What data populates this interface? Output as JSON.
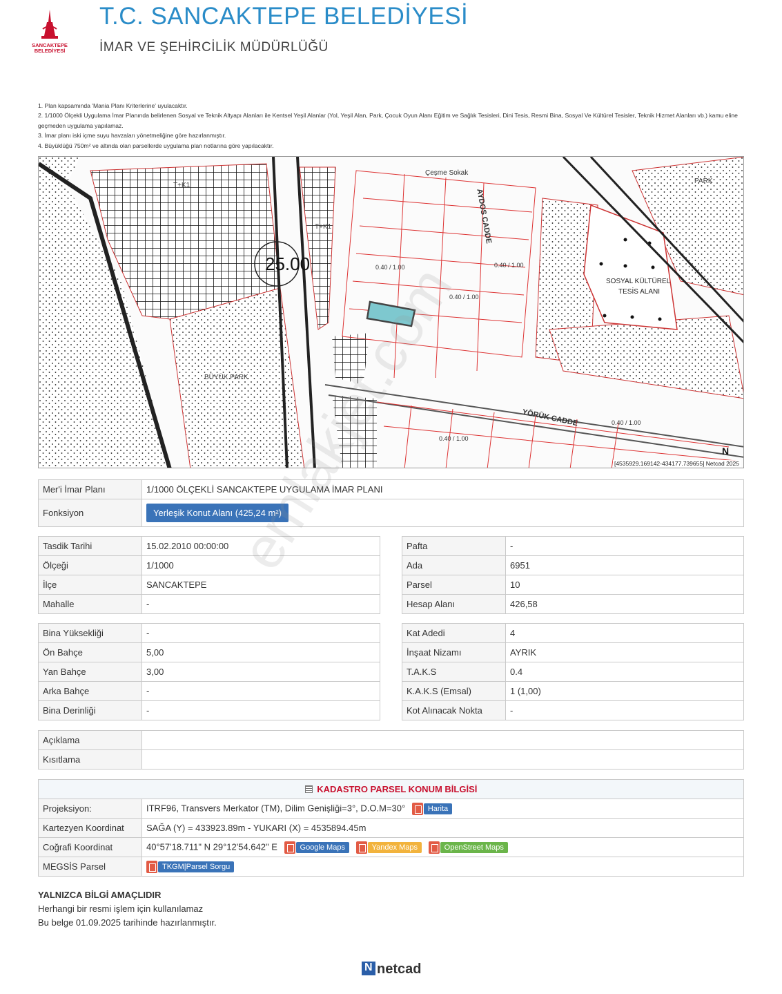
{
  "header": {
    "logo_text": "SANCAKTEPE BELEDİYESİ",
    "title": "T.C. SANCAKTEPE BELEDİYESİ",
    "subtitle": "İMAR VE ŞEHİRCİLİK MÜDÜRLÜĞÜ"
  },
  "notes": [
    "1. Plan kapsamında 'Mania Planı Kriterlerine' uyulacaktır.",
    "2. 1/1000 Ölçekli Uygulama İmar Planında belirlenen Sosyal ve Teknik Altyapı Alanları ile Kentsel Yeşil Alanlar (Yol, Yeşil Alan, Park, Çocuk Oyun Alanı Eğitim ve Sağlık Tesisleri, Dini Tesis, Resmi Bina, Sosyal Ve Kültürel Tesisler, Teknik Hizmet Alanları vb.) kamu eline geçmeden uygulama yapılamaz.",
    "3. İmar planı iski içme suyu havzaları yönetmeliğine göre hazırlanmıştır.",
    "4. Büyüklüğü 750m² ve altında olan parsellerde uygulama plan notlarına göre yapılacaktır."
  ],
  "map": {
    "coord_text": "[4535929.169142-434177.739655] Netcad 2025",
    "labels": {
      "park1": "PARK",
      "park2": "BÜYÜK PARK",
      "sosyal": "SOSYAL KÜLTÜREL",
      "tesis": "TESİS ALANI",
      "street1": "YÖRÜK CADDE",
      "street2": "AYDOS CADDE",
      "street3": "Çeşme Sokak",
      "zone": "25.00",
      "tk1": "T+K1",
      "tk2": "T+K1",
      "ratio1": "0.40 / 1.00",
      "ratio2": "0.40 / 1.00",
      "ratio3": "0.40 / 1.00",
      "ratio4": "0.40 / 1.00",
      "ratio5": "0.40 / 1.00",
      "north": "N"
    }
  },
  "plan": {
    "plan_label": "Mer'i İmar Planı",
    "plan_value": "1/1000 ÖLÇEKLİ SANCAKTEPE UYGULAMA İMAR PLANI",
    "fonk_label": "Fonksiyon",
    "fonk_value": "Yerleşik Konut Alanı (425,24 m²)"
  },
  "left1": [
    {
      "k": "Tasdik Tarihi",
      "v": "15.02.2010 00:00:00"
    },
    {
      "k": "Ölçeği",
      "v": "1/1000"
    },
    {
      "k": "İlçe",
      "v": "SANCAKTEPE"
    },
    {
      "k": "Mahalle",
      "v": "-"
    }
  ],
  "right1": [
    {
      "k": "Pafta",
      "v": "-"
    },
    {
      "k": "Ada",
      "v": "6951"
    },
    {
      "k": "Parsel",
      "v": "10"
    },
    {
      "k": "Hesap Alanı",
      "v": "426,58"
    }
  ],
  "left2": [
    {
      "k": "Bina Yüksekliği",
      "v": "-"
    },
    {
      "k": "Ön Bahçe",
      "v": "5,00"
    },
    {
      "k": "Yan Bahçe",
      "v": "3,00"
    },
    {
      "k": "Arka Bahçe",
      "v": "-"
    },
    {
      "k": "Bina Derinliği",
      "v": "-"
    }
  ],
  "right2": [
    {
      "k": "Kat Adedi",
      "v": "4"
    },
    {
      "k": "İnşaat Nizamı",
      "v": "AYRIK"
    },
    {
      "k": "T.A.K.S",
      "v": "0.4"
    },
    {
      "k": "K.A.K.S (Emsal)",
      "v": "1 (1,00)"
    },
    {
      "k": "Kot Alınacak Nokta",
      "v": "-"
    }
  ],
  "remarks": {
    "aciklama": "Açıklama",
    "kisitlama": "Kısıtlama"
  },
  "kadastro": {
    "title": "KADASTRO PARSEL KONUM BİLGİSİ",
    "proj_label": "Projeksiyon:",
    "proj_value": "ITRF96, Transvers Merkator (TM), Dilim Genişliği=3°, D.O.M=30°",
    "harita": "Harita",
    "kart_label": "Kartezyen Koordinat",
    "kart_value": "SAĞA (Y) = 433923.89m - YUKARI (X) = 4535894.45m",
    "cog_label": "Coğrafi Koordinat",
    "cog_value": "40°57'18.711\" N 29°12'54.642\" E",
    "google": "Google Maps",
    "yandex": "Yandex Maps",
    "osm": "OpenStreet Maps",
    "megsis_label": "MEGSİS Parsel",
    "tkgm": "TKGM|Parsel Sorgu"
  },
  "footer": {
    "line1": "YALNIZCA BİLGİ AMAÇLIDIR",
    "line2": "Herhangi bir resmi işlem için kullanılamaz",
    "line3": "Bu belge 01.09.2025 tarihinde hazırlanmıştır.",
    "brand": "netcad"
  },
  "watermark": "emlakjet.com",
  "colors": {
    "title_blue": "#2a8cc8",
    "brand_red": "#c8102e",
    "button_blue": "#3a73b8",
    "parcel_highlight": "#7ec8cf"
  }
}
